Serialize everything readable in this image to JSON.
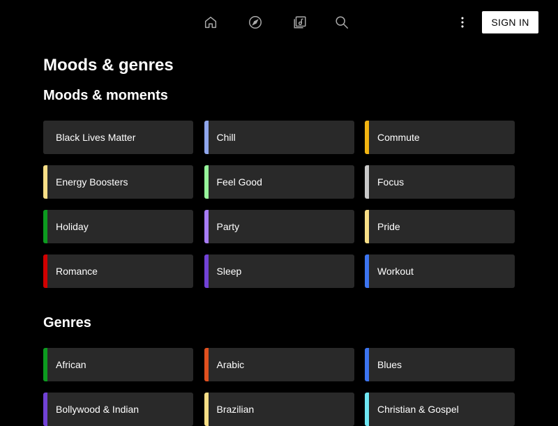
{
  "nav": {
    "icons": [
      "home-icon",
      "explore-icon",
      "library-icon",
      "search-icon"
    ],
    "more_icon": "more-vert-icon",
    "signin_label": "SIGN IN"
  },
  "page_title": "Moods & genres",
  "moods": {
    "title": "Moods & moments",
    "items": [
      {
        "label": "Black Lives Matter",
        "color": "#292929"
      },
      {
        "label": "Chill",
        "color": "#8fa6ec"
      },
      {
        "label": "Commute",
        "color": "#f2b411"
      },
      {
        "label": "Energy Boosters",
        "color": "#f7de86"
      },
      {
        "label": "Feel Good",
        "color": "#96f49a"
      },
      {
        "label": "Focus",
        "color": "#c9c9c9"
      },
      {
        "label": "Holiday",
        "color": "#0c9b1f"
      },
      {
        "label": "Party",
        "color": "#a77cf5"
      },
      {
        "label": "Pride",
        "color": "#f7de86"
      },
      {
        "label": "Romance",
        "color": "#d00000"
      },
      {
        "label": "Sleep",
        "color": "#7142d6"
      },
      {
        "label": "Workout",
        "color": "#3c74f0"
      }
    ]
  },
  "genres": {
    "title": "Genres",
    "items": [
      {
        "label": "African",
        "color": "#0c9b1f"
      },
      {
        "label": "Arabic",
        "color": "#e1501f"
      },
      {
        "label": "Blues",
        "color": "#3c74f0"
      },
      {
        "label": "Bollywood & Indian",
        "color": "#7142d6"
      },
      {
        "label": "Brazilian",
        "color": "#f7de86"
      },
      {
        "label": "Christian & Gospel",
        "color": "#6ee6f2"
      }
    ]
  }
}
